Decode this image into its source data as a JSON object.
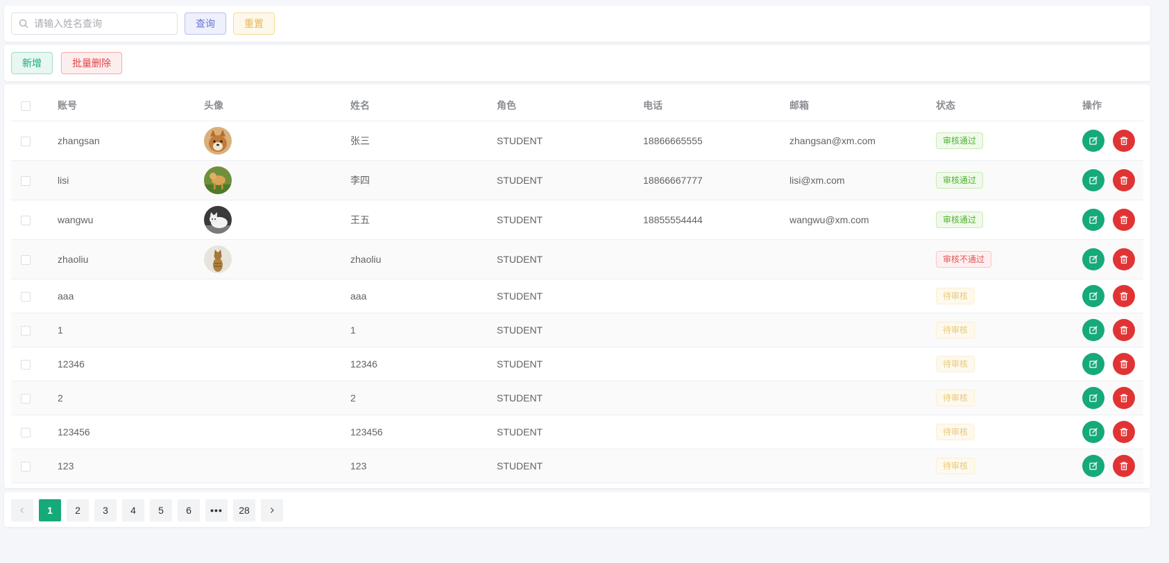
{
  "search": {
    "placeholder": "请输入姓名查询",
    "query_label": "查询",
    "reset_label": "重置"
  },
  "actions": {
    "add_label": "新增",
    "bulk_delete_label": "批量删除"
  },
  "table": {
    "headers": {
      "account": "账号",
      "avatar": "头像",
      "name": "姓名",
      "role": "角色",
      "phone": "电话",
      "email": "邮箱",
      "status": "状态",
      "ops": "操作"
    },
    "rows": [
      {
        "account": "zhangsan",
        "avatar": "dog-shiba",
        "name": "张三",
        "role": "STUDENT",
        "phone": "18866665555",
        "email": "zhangsan@xm.com",
        "status": "审核通过",
        "status_type": "pass"
      },
      {
        "account": "lisi",
        "avatar": "dog-golden",
        "name": "李四",
        "role": "STUDENT",
        "phone": "18866667777",
        "email": "lisi@xm.com",
        "status": "审核通过",
        "status_type": "pass"
      },
      {
        "account": "wangwu",
        "avatar": "cat-white",
        "name": "王五",
        "role": "STUDENT",
        "phone": "18855554444",
        "email": "wangwu@xm.com",
        "status": "审核通过",
        "status_type": "pass"
      },
      {
        "account": "zhaoliu",
        "avatar": "cat-tabby",
        "name": "zhaoliu",
        "role": "STUDENT",
        "phone": "",
        "email": "",
        "status": "审核不通过",
        "status_type": "fail"
      },
      {
        "account": "aaa",
        "avatar": "",
        "name": "aaa",
        "role": "STUDENT",
        "phone": "",
        "email": "",
        "status": "待审核",
        "status_type": "pending"
      },
      {
        "account": "1",
        "avatar": "",
        "name": "1",
        "role": "STUDENT",
        "phone": "",
        "email": "",
        "status": "待审核",
        "status_type": "pending"
      },
      {
        "account": "12346",
        "avatar": "",
        "name": "12346",
        "role": "STUDENT",
        "phone": "",
        "email": "",
        "status": "待审核",
        "status_type": "pending"
      },
      {
        "account": "2",
        "avatar": "",
        "name": "2",
        "role": "STUDENT",
        "phone": "",
        "email": "",
        "status": "待审核",
        "status_type": "pending"
      },
      {
        "account": "123456",
        "avatar": "",
        "name": "123456",
        "role": "STUDENT",
        "phone": "",
        "email": "",
        "status": "待审核",
        "status_type": "pending"
      },
      {
        "account": "123",
        "avatar": "",
        "name": "123",
        "role": "STUDENT",
        "phone": "",
        "email": "",
        "status": "待审核",
        "status_type": "pending"
      }
    ]
  },
  "pagination": {
    "prev_icon": "chevron-left-icon",
    "next_icon": "chevron-right-icon",
    "pages": [
      "1",
      "2",
      "3",
      "4",
      "5",
      "6"
    ],
    "more": "•••",
    "last": "28",
    "current": "1"
  },
  "colors": {
    "primary": "#16a97a",
    "danger": "#e03434",
    "query": "#6b73d6",
    "reset": "#e8b94d"
  }
}
